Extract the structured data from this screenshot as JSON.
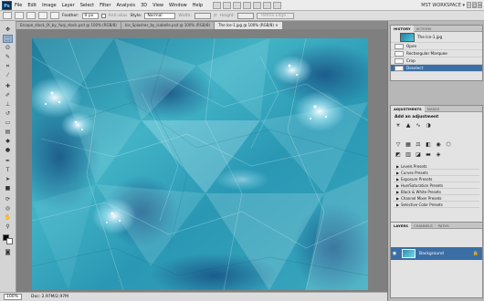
{
  "menu": {
    "logo": "Ps",
    "items": [
      "File",
      "Edit",
      "Image",
      "Layer",
      "Select",
      "Filter",
      "Analysis",
      "3D",
      "View",
      "Window",
      "Help"
    ],
    "workspace": "MST WORKSPACE ▾"
  },
  "options": {
    "feather_label": "Feather:",
    "feather_value": "0 px",
    "antialias_label": "Anti-alias",
    "style_label": "Style:",
    "style_value": "Normal",
    "width_label": "Width:",
    "height_label": "Height:",
    "refine_label": "Refine Edge..."
  },
  "tabs": [
    "Escape_stock_IX_by_Yuqi_stock.psd @ 100% (RGB/8)",
    "Ice_Splashes_by_Isabelle.psd @ 100% (RGB/8)",
    "The Ice-1.jpg @ 100% (RGB/8)"
  ],
  "active_tab": "The Ice-1.jpg @ 100% (RGB/8) ×",
  "status": {
    "zoom": "100%",
    "doc": "Doc: 2.97M/2.97M"
  },
  "history": {
    "tabs": [
      "HISTORY",
      "ACTIONS"
    ],
    "snapshot": "The Ice-1.jpg",
    "items": [
      "Open",
      "Rectangular Marquee",
      "Crop",
      "Deselect"
    ],
    "selected_index": 3
  },
  "adjustments": {
    "tabs": [
      "ADJUSTMENTS",
      "MASKS"
    ],
    "heading": "Add an adjustment",
    "presets": [
      "Levels Presets",
      "Curves Presets",
      "Exposure Presets",
      "Hue/Saturation Presets",
      "Black & White Presets",
      "Channel Mixer Presets",
      "Selective Color Presets"
    ]
  },
  "layers": {
    "tabs": [
      "LAYERS",
      "CHANNELS",
      "PATHS"
    ],
    "layer_name": "Background"
  }
}
